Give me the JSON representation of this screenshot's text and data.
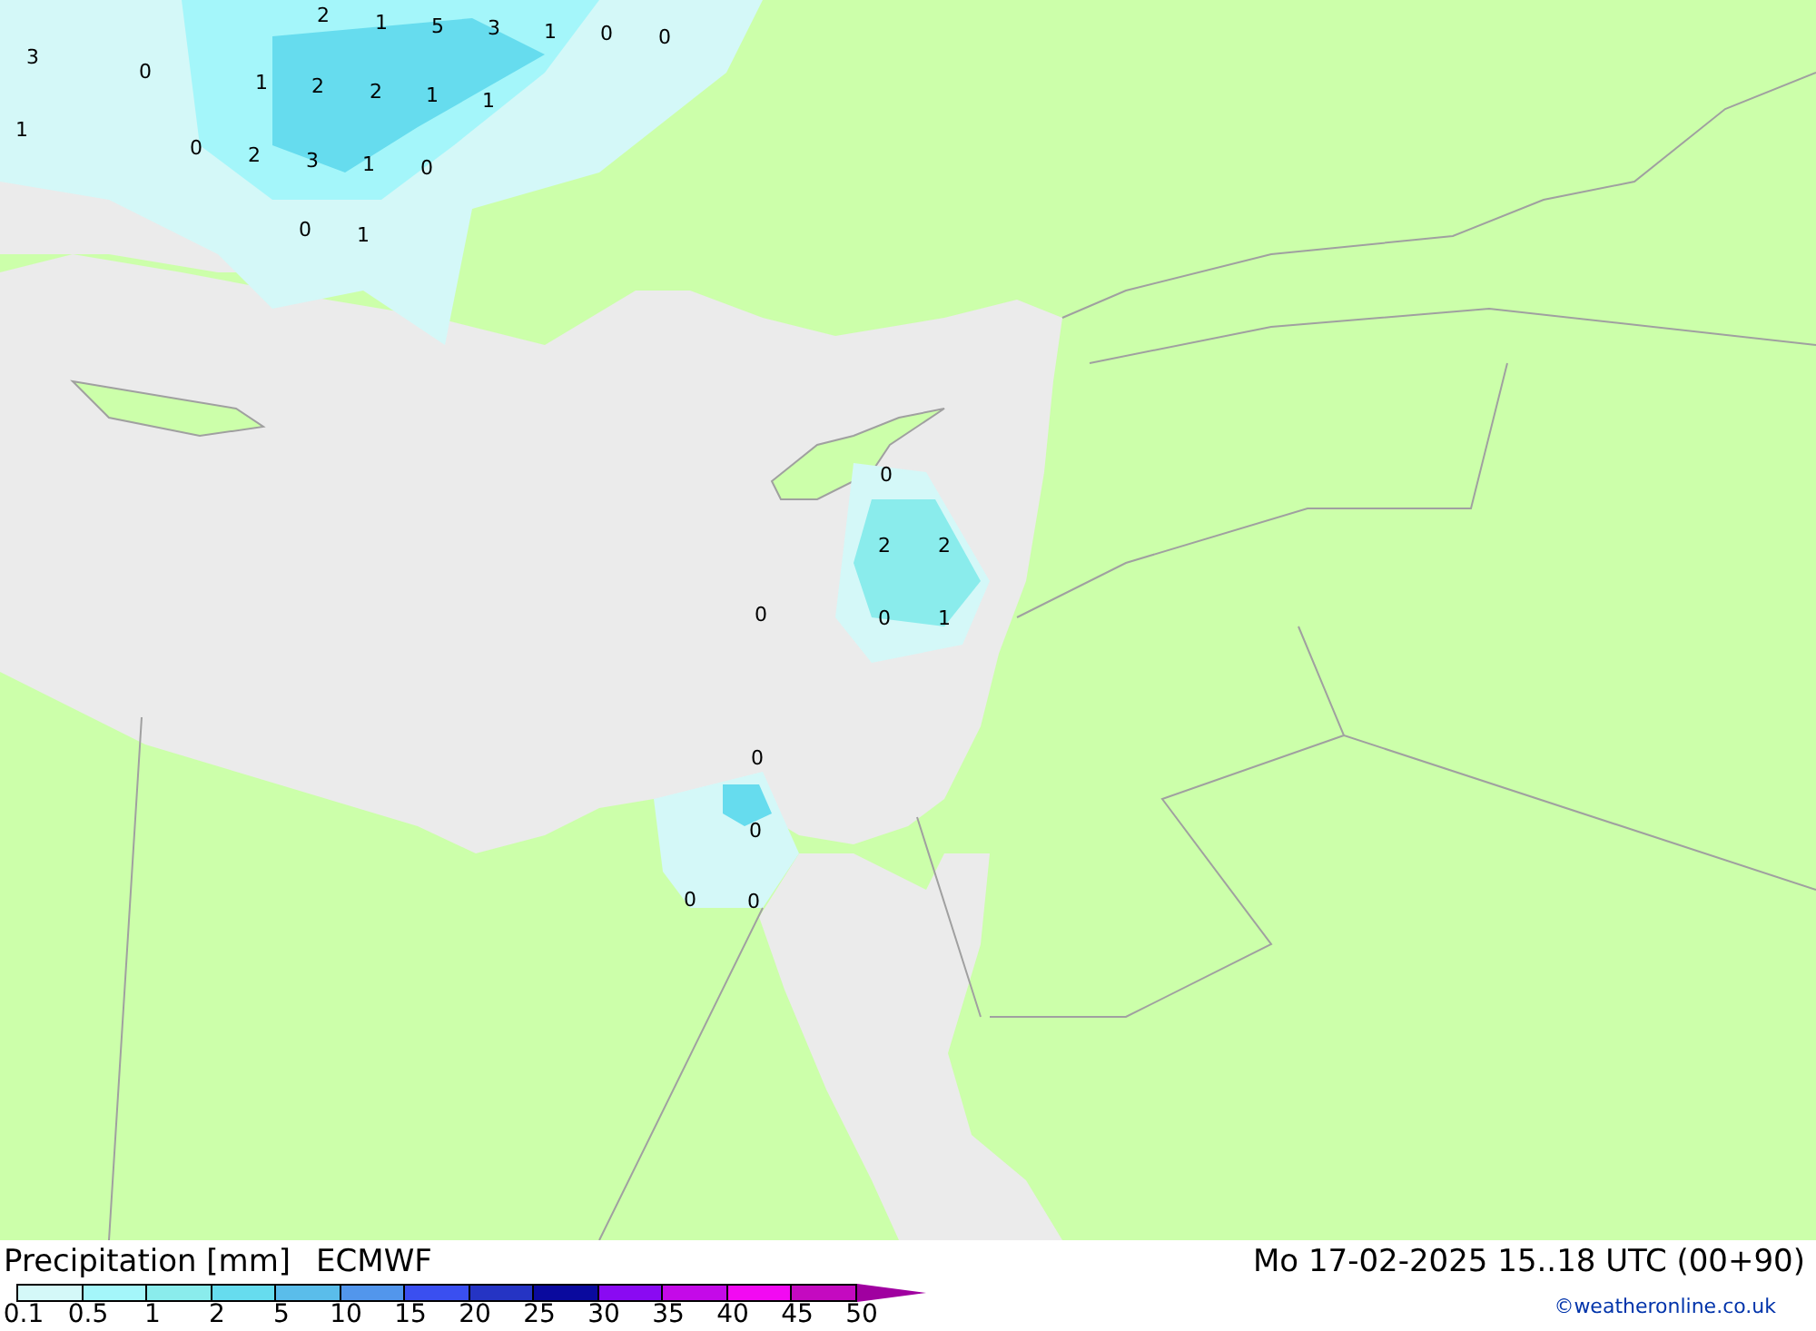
{
  "map": {
    "value_labels": [
      "2",
      "1",
      "5",
      "3",
      "1",
      "0",
      "0",
      "3",
      "0",
      "1",
      "2",
      "2",
      "1",
      "1",
      "1",
      "0",
      "2",
      "3",
      "1",
      "0",
      "0",
      "1",
      "0",
      "2",
      "2",
      "0",
      "0",
      "1",
      "0",
      "0",
      "0",
      "0"
    ]
  },
  "footer": {
    "title": "Precipitation [mm]",
    "model": "ECMWF",
    "valid_time": "Mo 17-02-2025 15..18 UTC (00+90)",
    "credit": "©weatheronline.co.uk"
  },
  "legend": {
    "bins": [
      {
        "color": "#d4f8f8"
      },
      {
        "color": "#a4f6fa"
      },
      {
        "color": "#8aecec"
      },
      {
        "color": "#66dcee"
      },
      {
        "color": "#5abdea"
      },
      {
        "color": "#5296ec"
      },
      {
        "color": "#3a4ff0"
      },
      {
        "color": "#2534c4"
      },
      {
        "color": "#0a0a9e"
      },
      {
        "color": "#8a0af2"
      },
      {
        "color": "#c40ae8"
      },
      {
        "color": "#f20af2"
      },
      {
        "color": "#c40ac0"
      }
    ],
    "overflow_arrow": {
      "color": "#a000a0"
    },
    "ticks": [
      "0.1",
      "0.5",
      "1",
      "2",
      "5",
      "10",
      "15",
      "20",
      "25",
      "30",
      "35",
      "40",
      "45",
      "50"
    ]
  }
}
